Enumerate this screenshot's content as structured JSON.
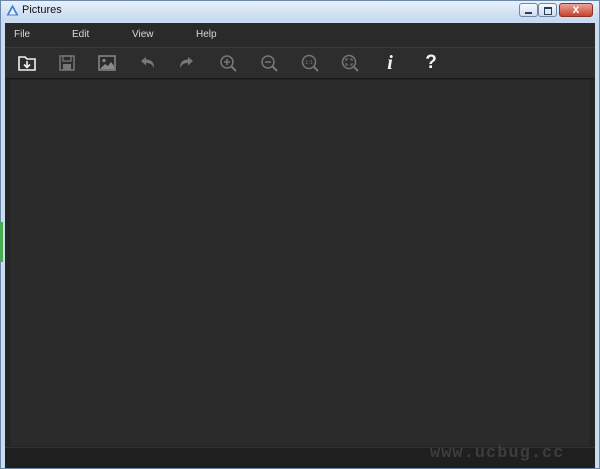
{
  "window": {
    "title": "Pictures",
    "title_path": "",
    "close_glyph": "x"
  },
  "menu": [
    {
      "label": "File"
    },
    {
      "label": "Edit"
    },
    {
      "label": "View"
    },
    {
      "label": "Help"
    }
  ],
  "toolbar": [
    {
      "name": "open-folder-icon"
    },
    {
      "name": "save-icon"
    },
    {
      "name": "image-icon"
    },
    {
      "name": "undo-icon"
    },
    {
      "name": "redo-icon"
    },
    {
      "name": "zoom-in-icon"
    },
    {
      "name": "zoom-out-icon"
    },
    {
      "name": "actual-size-icon",
      "text": "1:1"
    },
    {
      "name": "fit-to-window-icon"
    },
    {
      "name": "info-icon",
      "text": "i"
    },
    {
      "name": "help-icon",
      "text": "?"
    }
  ],
  "watermark": "www.ucbug.cc",
  "colors": {
    "background": "#262626",
    "toolbar": "#2d2d2d",
    "icon_active": "#f2f2f2",
    "icon_disabled": "#777777"
  }
}
